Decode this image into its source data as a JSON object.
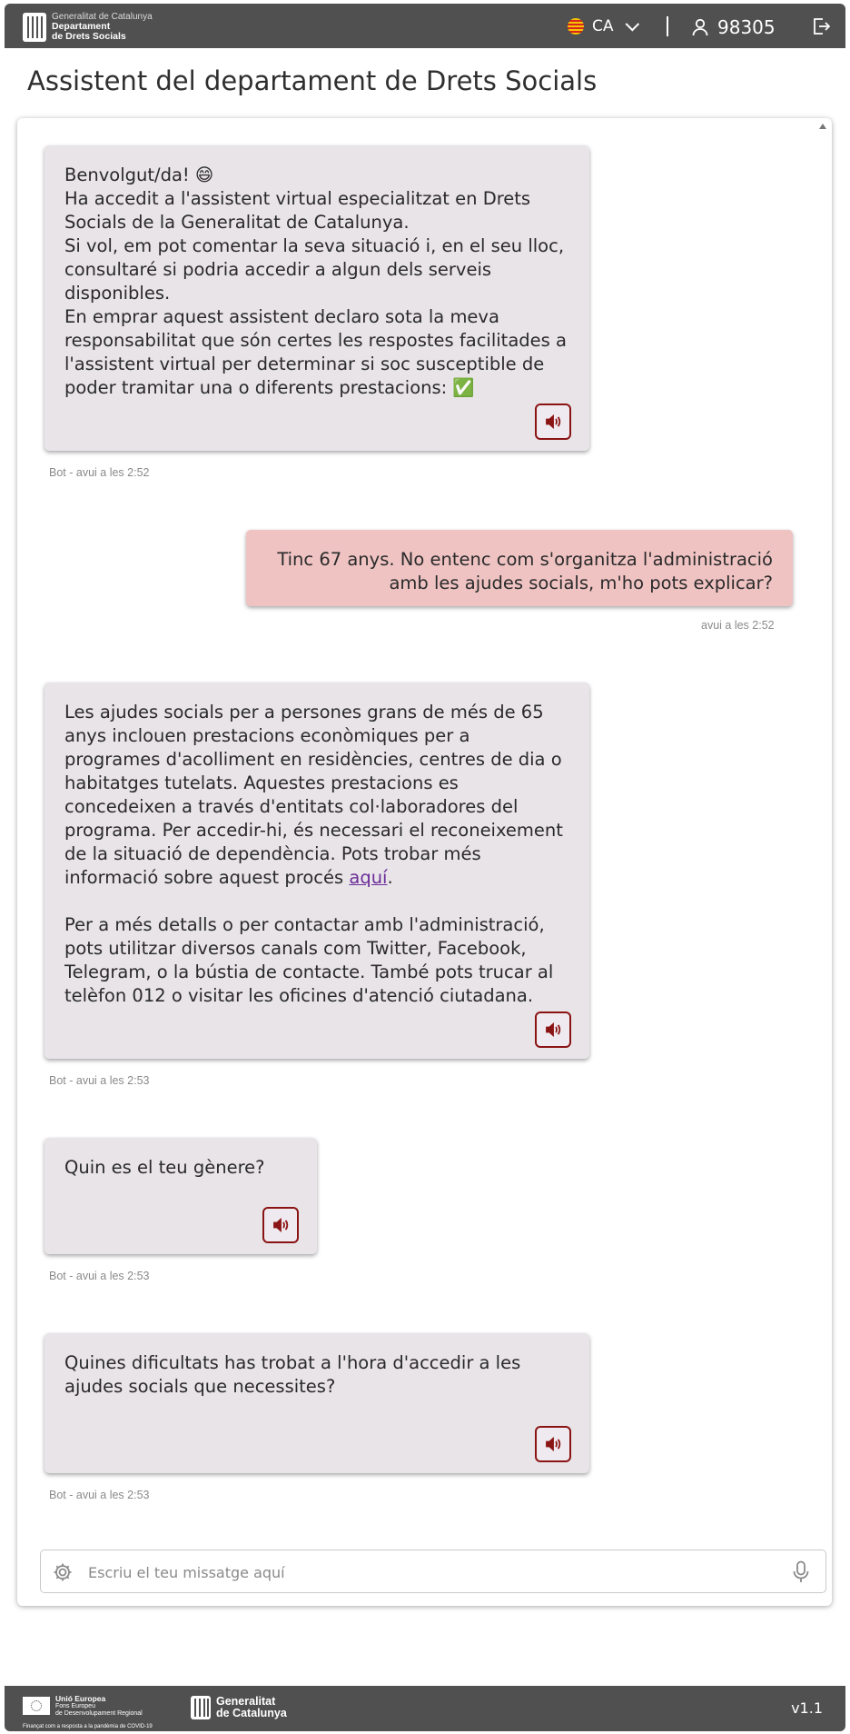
{
  "header": {
    "org_line1": "Generalitat de Catalunya",
    "org_line2": "Departament",
    "org_line3": "de Drets Socials",
    "language": "CA",
    "user_id": "98305"
  },
  "page": {
    "title": "Assistent del departament de Drets Socials"
  },
  "messages": [
    {
      "lines": [
        "Benvolgut/da! 😄",
        "Ha accedit a l'assistent virtual especialitzat en Drets Socials de la Generalitat de Catalunya.",
        "Si vol, em pot comentar la seva situació i, en el seu lloc, consultaré si podria accedir a algun dels serveis disponibles.",
        "En emprar aquest assistent declaro sota la meva responsabilitat que són certes les respostes facilitades a l'assistent virtual per determinar si soc susceptible de poder tramitar una o diferents prestacions: ✅"
      ],
      "meta": "Bot - avui a les 2:52"
    },
    {
      "text": "Tinc 67 anys. No entenc com s'organitza l'administració amb les ajudes socials, m'ho pots explicar?",
      "meta": "avui a les 2:52"
    },
    {
      "p1": "Les ajudes socials per a persones grans de més de 65 anys inclouen prestacions econòmiques per a programes d'acolliment en residències, centres de dia o habitatges tutelats. Aquestes prestacions es concedeixen a través d'entitats col·laboradores del programa. Per accedir-hi, és necessari el reconeixement de la situació de dependència. Pots trobar més informació sobre aquest procés ",
      "link": "aquí",
      "p1_end": ".",
      "p2": "Per a més detalls o per contactar amb l'administració, pots utilitzar diversos canals com Twitter, Facebook, Telegram, o la bústia de contacte. També pots trucar al telèfon 012 o visitar les oficines d'atenció ciutadana.",
      "meta": "Bot - avui a les 2:53"
    },
    {
      "text": "Quin es el teu gènere?",
      "meta": "Bot - avui a les 2:53"
    },
    {
      "text": "Quines dificultats has trobat a l'hora d'accedir a les ajudes socials que necessites?",
      "meta": "Bot - avui a les 2:53"
    }
  ],
  "composer": {
    "placeholder": "Escriu el teu missatge aquí",
    "value": ""
  },
  "footer": {
    "eu_line1": "Unió Europea",
    "eu_line2": "Fons Europeu",
    "eu_line3": "de Desenvolupament Regional",
    "eu_note": "Finançat com a resposta a la pandèmia de COVID-19",
    "gen_line1": "Generalitat",
    "gen_line2": "de Catalunya",
    "version": "v1.1"
  },
  "colors": {
    "header_bg": "#505050",
    "bot_bubble": "#e8e4e8",
    "user_bubble": "#f0c3c3",
    "speak_border": "#8a1414",
    "link": "#6b2d9a"
  },
  "icons": [
    "flag-icon",
    "chevron-down-icon",
    "user-icon",
    "logout-icon",
    "speaker-icon",
    "gear-icon",
    "microphone-icon"
  ]
}
